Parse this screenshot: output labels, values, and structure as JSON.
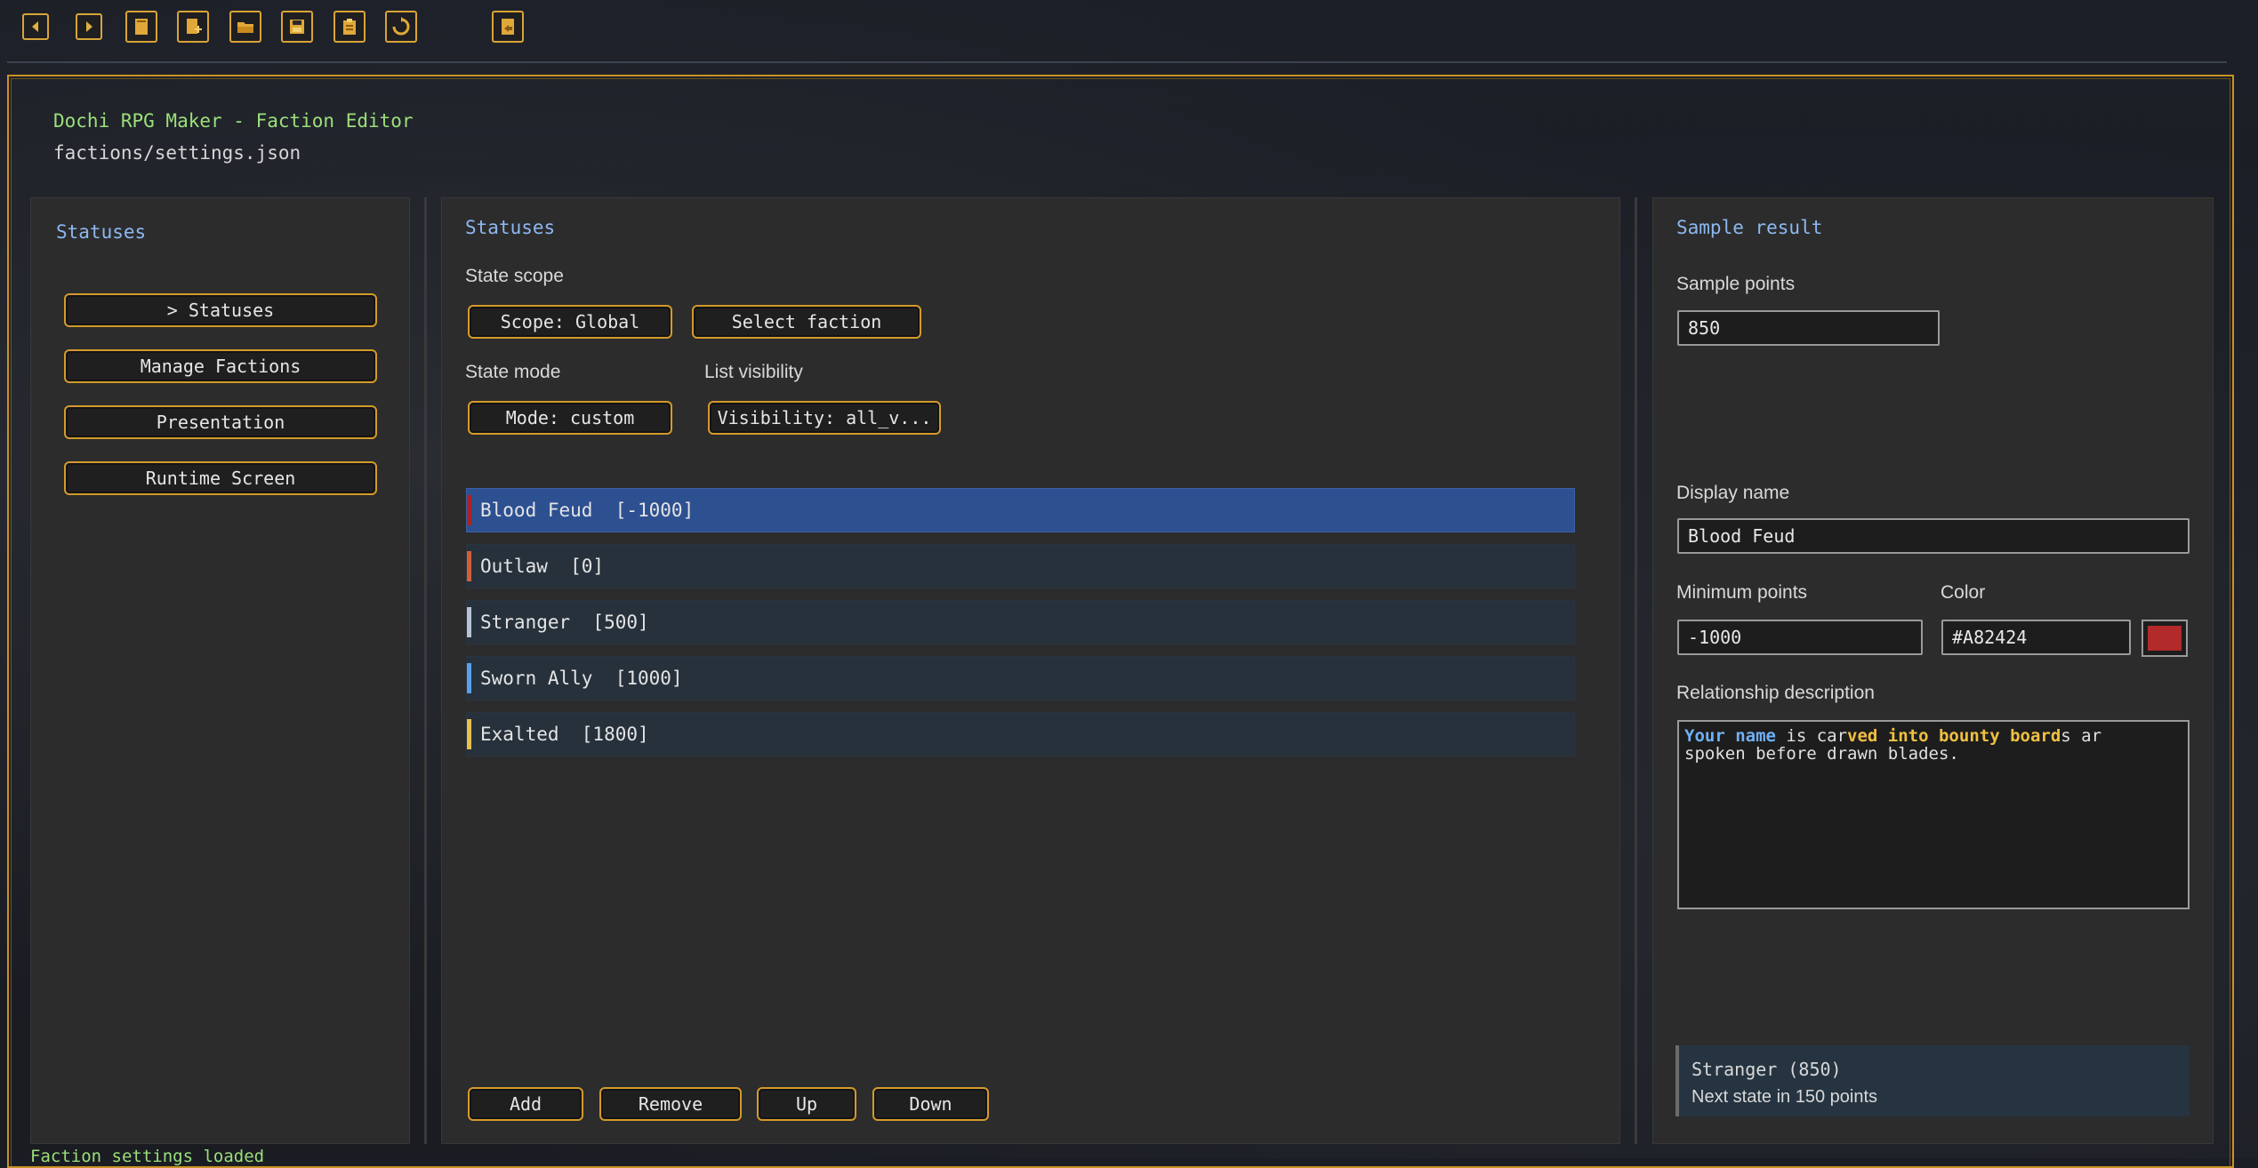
{
  "app": {
    "title": "Dochi RPG Maker - Faction Editor",
    "path": "factions/settings.json",
    "status": "Faction settings loaded"
  },
  "toolbar": {
    "icons": [
      "back-icon",
      "forward-icon",
      "book-icon",
      "new-file-icon",
      "open-folder-icon",
      "save-icon",
      "clipboard-icon",
      "reload-icon",
      "export-icon"
    ],
    "accent": "#d9a437"
  },
  "sidebar": {
    "heading": "Statuses",
    "items": [
      {
        "label": "> Statuses"
      },
      {
        "label": "Manage Factions"
      },
      {
        "label": "Presentation"
      },
      {
        "label": "Runtime Screen"
      }
    ]
  },
  "main": {
    "heading": "Statuses",
    "state_scope_label": "State scope",
    "scope_button": "Scope: Global",
    "select_faction_button": "Select faction",
    "state_mode_label": "State mode",
    "list_visibility_label": "List visibility",
    "mode_button": "Mode: custom",
    "visibility_button": "Visibility: all_v...",
    "statuses": [
      {
        "label": "Blood Feud  [-1000]",
        "color": "#a82424",
        "selected": true
      },
      {
        "label": "Outlaw  [0]",
        "color": "#d0603a",
        "selected": false
      },
      {
        "label": "Stranger  [500]",
        "color": "#b8c4d4",
        "selected": false
      },
      {
        "label": "Sworn Ally  [1000]",
        "color": "#5aa0e8",
        "selected": false
      },
      {
        "label": "Exalted  [1800]",
        "color": "#e8c050",
        "selected": false
      }
    ],
    "actions": {
      "add": "Add",
      "remove": "Remove",
      "up": "Up",
      "down": "Down"
    }
  },
  "inspector": {
    "heading": "Sample result",
    "sample_points_label": "Sample points",
    "sample_points_value": "850",
    "display_name_label": "Display name",
    "display_name_value": "Blood Feud",
    "minimum_points_label": "Minimum points",
    "minimum_points_value": "-1000",
    "color_label": "Color",
    "color_value": "#A82424",
    "swatch_color": "#b22a2a",
    "relationship_label": "Relationship description",
    "description": {
      "p1": "Your name",
      "p2": " i",
      "p3": "s car",
      "p4": "ved into bounty board",
      "p5": "s ar",
      "line2": "spoken before drawn blades."
    },
    "result_line1": "Stranger (850)",
    "result_line2": "Next state in 150 points"
  }
}
